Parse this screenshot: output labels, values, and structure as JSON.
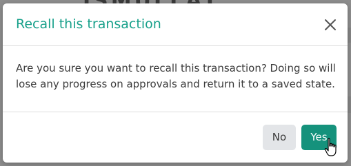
{
  "backdrop": {
    "partial_title": "ISMULLAT"
  },
  "dialog": {
    "title": "Recall this transaction",
    "close_icon": "close-icon",
    "message": "Are you sure you want to recall this transaction? Doing so will lose any progress on approvals and return it to a saved state.",
    "buttons": {
      "no_label": "No",
      "yes_label": "Yes"
    }
  },
  "cursor": {
    "icon": "hand-pointer-icon"
  },
  "colors": {
    "accent": "#17a08a",
    "primary_button": "#15927c",
    "secondary_button": "#e3e5e8",
    "text": "#3b3b3b",
    "divider": "#dcdcdc"
  }
}
